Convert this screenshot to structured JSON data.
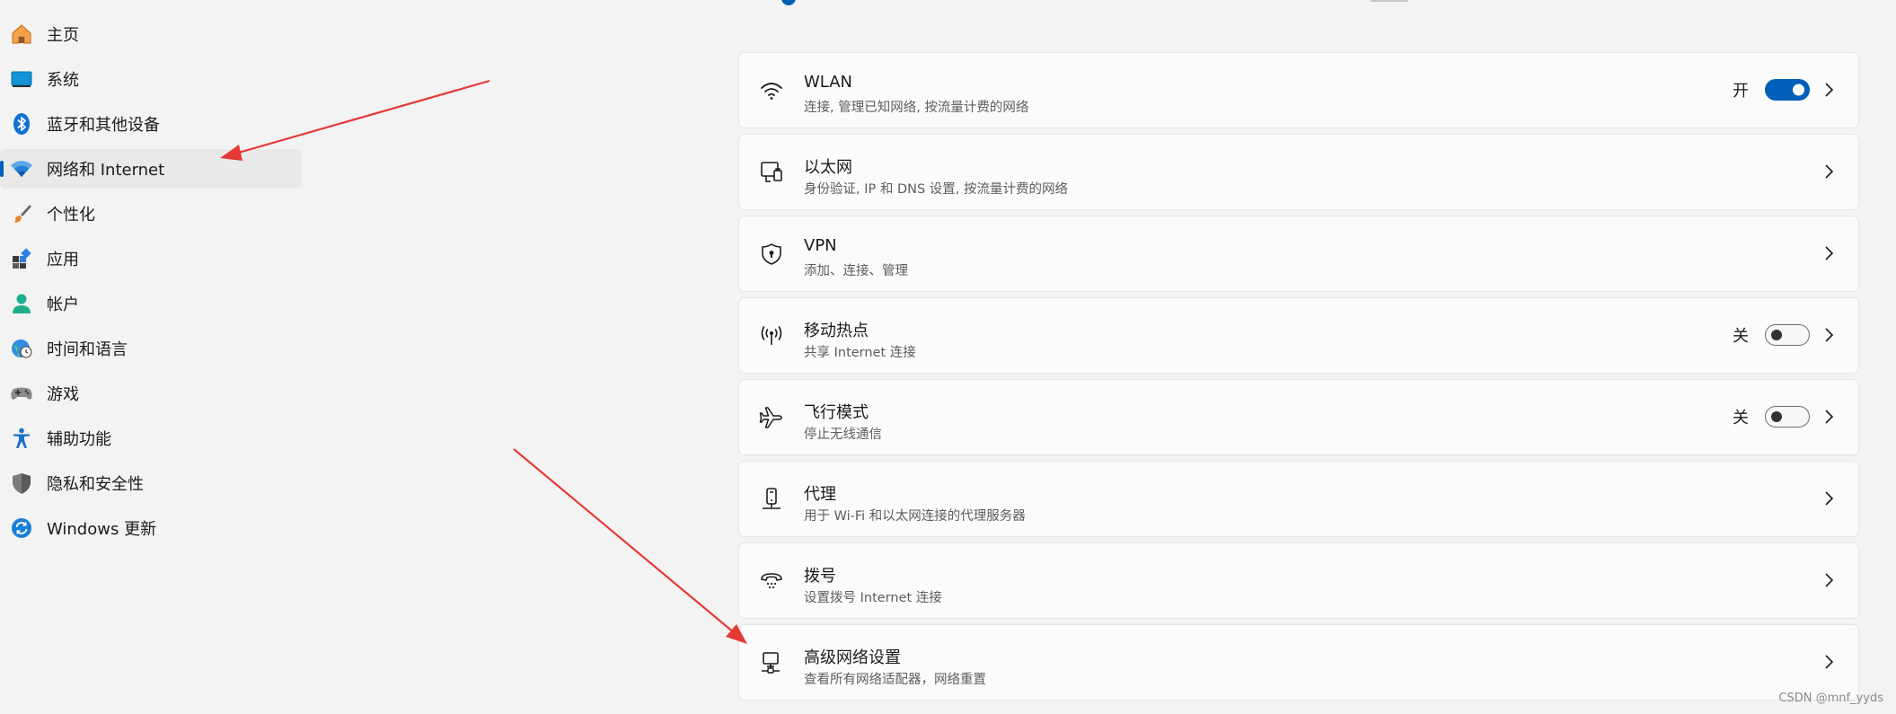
{
  "sidebar": {
    "items": [
      {
        "label": "主页",
        "icon": "home-icon"
      },
      {
        "label": "系统",
        "icon": "system-display-icon"
      },
      {
        "label": "蓝牙和其他设备",
        "icon": "bluetooth-icon"
      },
      {
        "label": "网络和 Internet",
        "icon": "wifi-network-icon",
        "active": true
      },
      {
        "label": "个性化",
        "icon": "paintbrush-icon"
      },
      {
        "label": "应用",
        "icon": "apps-icon"
      },
      {
        "label": "帐户",
        "icon": "account-person-icon"
      },
      {
        "label": "时间和语言",
        "icon": "globe-clock-icon"
      },
      {
        "label": "游戏",
        "icon": "gamepad-icon"
      },
      {
        "label": "辅助功能",
        "icon": "accessibility-icon"
      },
      {
        "label": "隐私和安全性",
        "icon": "shield-icon"
      },
      {
        "label": "Windows 更新",
        "icon": "update-sync-icon"
      }
    ]
  },
  "main": {
    "cards": [
      {
        "title": "WLAN",
        "subtitle": "连接, 管理已知网络, 按流量计费的网络",
        "icon": "wifi-icon",
        "toggle": {
          "label": "开",
          "on": true
        }
      },
      {
        "title": "以太网",
        "subtitle": "身份验证, IP 和 DNS 设置, 按流量计费的网络",
        "icon": "ethernet-icon"
      },
      {
        "title": "VPN",
        "subtitle": "添加、连接、管理",
        "icon": "vpn-shield-icon"
      },
      {
        "title": "移动热点",
        "subtitle": "共享 Internet 连接",
        "icon": "hotspot-icon",
        "toggle": {
          "label": "关",
          "on": false
        }
      },
      {
        "title": "飞行模式",
        "subtitle": "停止无线通信",
        "icon": "airplane-icon",
        "toggle": {
          "label": "关",
          "on": false
        }
      },
      {
        "title": "代理",
        "subtitle": "用于 Wi-Fi 和以太网连接的代理服务器",
        "icon": "proxy-server-icon"
      },
      {
        "title": "拨号",
        "subtitle": "设置拨号 Internet 连接",
        "icon": "dialup-phone-icon"
      },
      {
        "title": "高级网络设置",
        "subtitle": "查看所有网络适配器，网络重置",
        "icon": "advanced-network-icon"
      }
    ]
  },
  "watermark": "CSDN @mnf_yyds",
  "colors": {
    "accent": "#005fb8",
    "annotation_arrow": "#e53935",
    "background": "#f3f3f3",
    "card": "#fbfbfb"
  }
}
